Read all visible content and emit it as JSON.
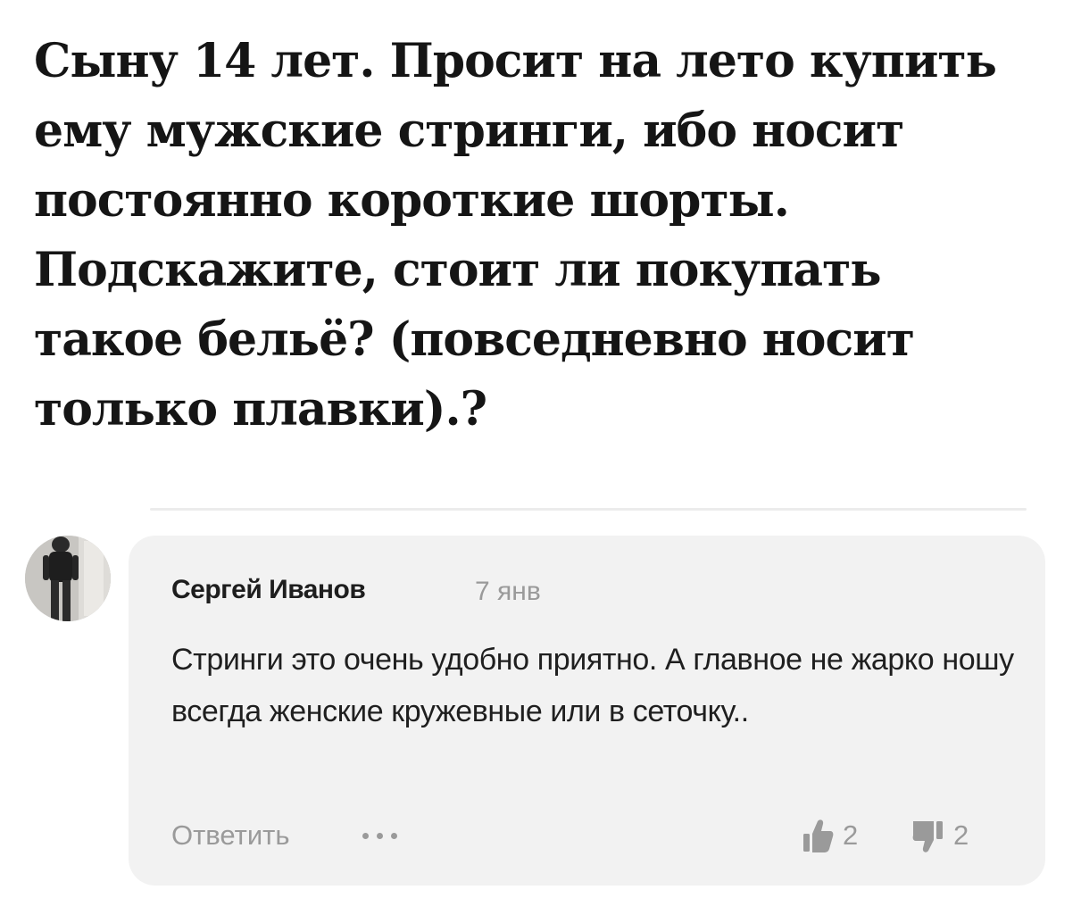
{
  "question": {
    "text": "Сыну 14 лет. Просит на лето купить ему мужские стринги, ибо носит постоянно короткие шорты. Подскажите, стоит ли покупать такое бельё? (повседневно носит только плавки).?"
  },
  "comment": {
    "author": "Сергей Иванов",
    "date": "7 янв",
    "text": "Стринги это очень удобно приятно. А главное не жарко ношу всегда женские кружевные или в сеточку..",
    "reply_label": "Ответить",
    "likes": "2",
    "dislikes": "2",
    "like_icon": "thumbs-up-icon",
    "dislike_icon": "thumbs-down-icon",
    "more_icon": "more-dots-icon"
  },
  "colors": {
    "card_background": "#f2f2f2",
    "muted_text": "#9a9a9a",
    "main_text": "#151515"
  }
}
